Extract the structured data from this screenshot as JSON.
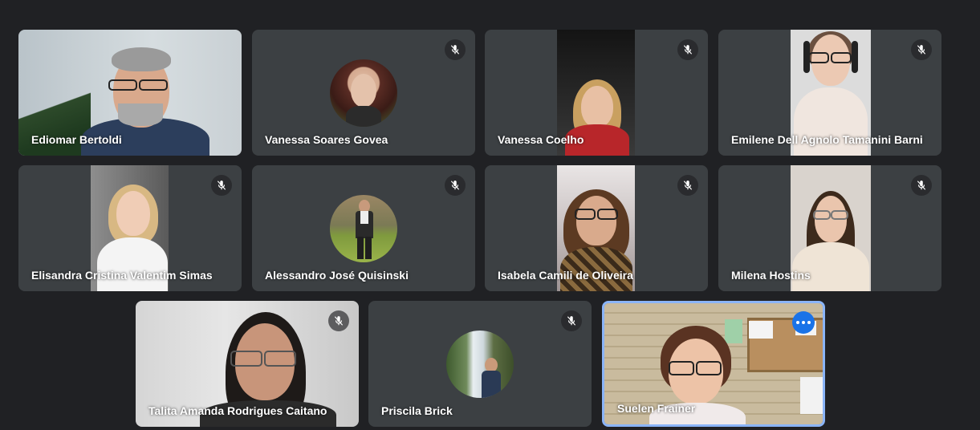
{
  "participants": [
    {
      "name": "Ediomar Bertoldi",
      "muted": false
    },
    {
      "name": "Vanessa Soares Govea",
      "muted": true
    },
    {
      "name": "Vanessa Coelho",
      "muted": true
    },
    {
      "name": "Emilene Dell Agnolo Tamanini Barni",
      "muted": true
    },
    {
      "name": "Elisandra Cristina Valentim Simas",
      "muted": true
    },
    {
      "name": "Alessandro José Quisinski",
      "muted": true
    },
    {
      "name": "Isabela Camili de Oliveira",
      "muted": true
    },
    {
      "name": "Milena Hostins",
      "muted": true
    },
    {
      "name": "Talita Amanda Rodrigues Caitano",
      "muted": true
    },
    {
      "name": "Priscila Brick",
      "muted": true
    },
    {
      "name": "Suelen Frainer",
      "muted": false,
      "self": true
    }
  ],
  "colors": {
    "background": "#202124",
    "tile": "#3c4043",
    "active_border": "#8ab4f8",
    "more_button": "#1a73e8"
  },
  "icons": {
    "mute": "mic-off-icon",
    "more": "more-options-icon"
  }
}
